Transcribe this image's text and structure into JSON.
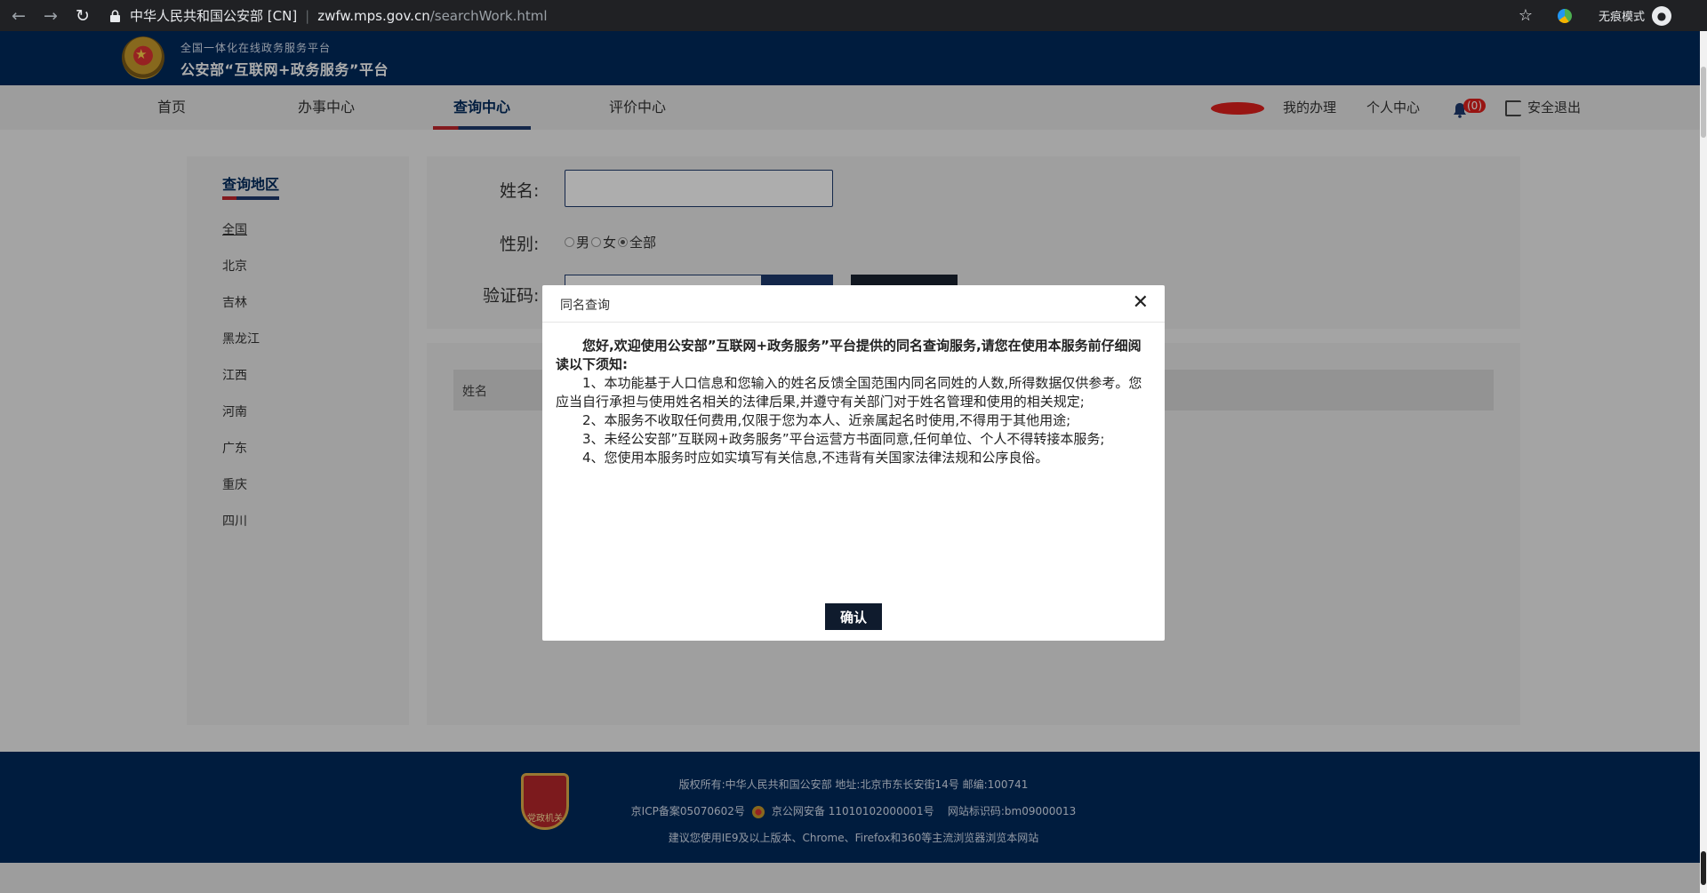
{
  "browser": {
    "site_name": "中华人民共和国公安部 [CN]",
    "url_host": "zwfw.mps.gov.cn",
    "url_path": "/searchWork.html",
    "incognito_label": "无痕模式"
  },
  "header": {
    "subtitle": "全国一体化在线政务服务平台",
    "title": "公安部“互联网+政务服务”平台"
  },
  "nav": {
    "items": [
      {
        "label": "首页"
      },
      {
        "label": "办事中心"
      },
      {
        "label": "查询中心",
        "active": true
      },
      {
        "label": "评价中心"
      }
    ],
    "my_affairs": "我的办理",
    "personal_center": "个人中心",
    "notification_count": "(0)",
    "logout": "安全退出"
  },
  "sidebar": {
    "title": "查询地区",
    "regions": [
      "全国",
      "北京",
      "吉林",
      "黑龙江",
      "江西",
      "河南",
      "广东",
      "重庆",
      "四川"
    ],
    "selected": "全国"
  },
  "form": {
    "name_label": "姓名:",
    "name_value": "",
    "gender_label": "性别:",
    "gender_options": [
      "男",
      "女",
      "全部"
    ],
    "gender_selected": "全部",
    "captcha_label": "验证码:"
  },
  "results": {
    "columns": [
      "姓名"
    ]
  },
  "modal": {
    "title": "同名查询",
    "lead": "您好,欢迎使用公安部”互联网+政务服务”平台提供的同名查询服务,请您在使用本服务前仔细阅读以下须知:",
    "items": [
      "1、本功能基于人口信息和您输入的姓名反馈全国范围内同名同姓的人数,所得数据仅供参考。您应当自行承担与使用姓名相关的法律后果,并遵守有关部门对于姓名管理和使用的相关规定;",
      "2、本服务不收取任何费用,仅限于您为本人、近亲属起名时使用,不得用于其他用途;",
      "3、未经公安部”互联网+政务服务”平台运营方书面同意,任何单位、个人不得转接本服务;",
      "4、您使用本服务时应如实填写有关信息,不违背有关国家法律法规和公序良俗。"
    ],
    "confirm": "确认"
  },
  "footer": {
    "logo_text": "党政机关",
    "line1": "版权所有:中华人民共和国公安部     地址:北京市东长安街14号    邮编:100741",
    "icp": "京ICP备案05070602号",
    "police_record": "京公网安备 11010102000001号",
    "site_code": "网站标识码:bm09000013",
    "line3": "建议您使用IE9及以上版本、Chrome、Firefox和360等主流浏览器浏览本网站"
  }
}
